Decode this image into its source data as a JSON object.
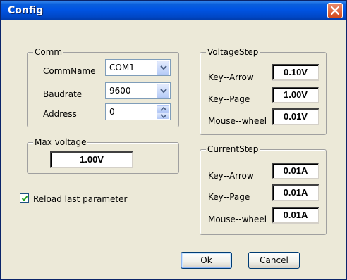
{
  "window": {
    "title": "Config"
  },
  "comm": {
    "legend": "Comm",
    "comm_name_label": "CommName",
    "comm_name_value": "COM1",
    "baudrate_label": "Baudrate",
    "baudrate_value": "9600",
    "address_label": "Address",
    "address_value": "0"
  },
  "max_voltage": {
    "legend": "Max voltage",
    "value": "1.00V"
  },
  "reload": {
    "label": "Reload last parameter",
    "checked": true
  },
  "voltage_step": {
    "legend": "VoltageStep",
    "key_arrow_label": "Key--Arrow",
    "key_arrow_value": "0.10V",
    "key_page_label": "Key--Page",
    "key_page_value": "1.00V",
    "mouse_wheel_label": "Mouse--wheel",
    "mouse_wheel_value": "0.01V"
  },
  "current_step": {
    "legend": "CurrentStep",
    "key_arrow_label": "Key--Arrow",
    "key_arrow_value": "0.01A",
    "key_page_label": "Key--Page",
    "key_page_value": "0.01A",
    "mouse_wheel_label": "Mouse--wheel",
    "mouse_wheel_value": "0.01A"
  },
  "buttons": {
    "ok": "Ok",
    "cancel": "Cancel"
  },
  "icons": {
    "close": "close-icon",
    "dropdown": "chevron-down-icon",
    "spin_up": "spin-up-icon",
    "spin_down": "spin-down-icon",
    "check": "checkmark-icon"
  },
  "colors": {
    "titlebar": "#0054e3",
    "dialog_bg": "#ece9d8",
    "close_button": "#d24a1c"
  }
}
